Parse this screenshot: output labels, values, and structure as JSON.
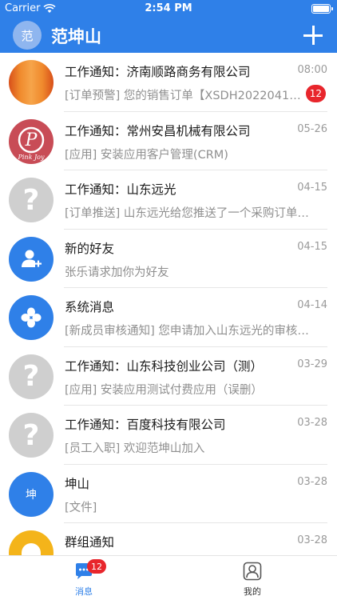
{
  "status_bar": {
    "carrier": "Carrier",
    "time": "2:54 PM"
  },
  "nav": {
    "avatar_text": "范",
    "title": "范坤山"
  },
  "conversations": [
    {
      "name": "工作通知：济南顺路商务有限公司",
      "date": "08:00",
      "preview": "[订单预警] 您的销售订单【XSDH2022041…",
      "badge": "12",
      "icon": "orange-logo-icon"
    },
    {
      "name": "工作通知：常州安昌机械有限公司",
      "date": "05-26",
      "preview": "[应用] 安装应用客户管理(CRM)",
      "icon": "pink-logo-icon"
    },
    {
      "name": "工作通知：山东远光",
      "date": "04-15",
      "preview": "[订单推送] 山东远光给您推送了一个采购订单…",
      "icon": "question-mark-icon"
    },
    {
      "name": "新的好友",
      "date": "04-15",
      "preview": "张乐请求加你为好友",
      "icon": "add-friend-icon"
    },
    {
      "name": "系统消息",
      "date": "04-14",
      "preview": "[新成员审核通知] 您申请加入山东远光的审核…",
      "icon": "system-grid-icon"
    },
    {
      "name": "工作通知：山东科技创业公司（测）",
      "date": "03-29",
      "preview": "[应用] 安装应用测试付费应用（误删）",
      "icon": "question-mark-icon"
    },
    {
      "name": "工作通知：百度科技有限公司",
      "date": "03-28",
      "preview": "[员工入职] 欢迎范坤山加入",
      "icon": "question-mark-icon"
    },
    {
      "name": "坤山",
      "date": "03-28",
      "preview": "[文件]",
      "avatar_text": "坤",
      "icon": "text-avatar"
    },
    {
      "name": "群组通知",
      "date": "03-28",
      "preview": "",
      "icon": "group-notice-icon"
    }
  ],
  "tabs": [
    {
      "label": "消息",
      "badge": "12",
      "icon": "message-icon",
      "active": true
    },
    {
      "label": "我的",
      "icon": "profile-icon",
      "active": false
    }
  ],
  "colors": {
    "primary": "#2f80e8",
    "badge": "#e8262c"
  }
}
